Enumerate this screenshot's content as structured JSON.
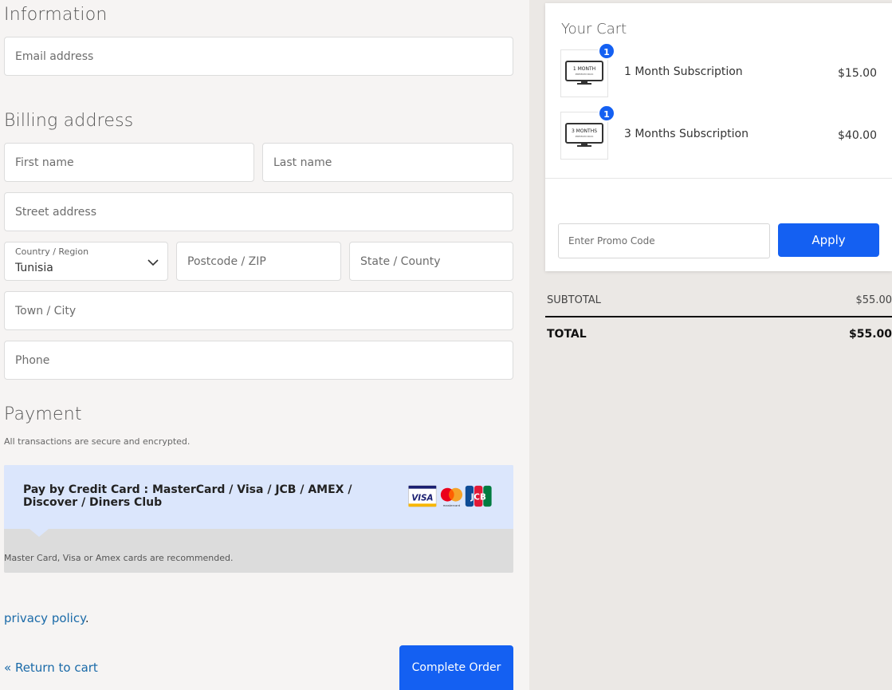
{
  "information": {
    "title": "Information",
    "email_placeholder": "Email address"
  },
  "billing": {
    "title": "Billing address",
    "first_name_placeholder": "First name",
    "last_name_placeholder": "Last name",
    "street_placeholder": "Street address",
    "country_label": "Country / Region",
    "country_value": "Tunisia",
    "postcode_placeholder": "Postcode / ZIP",
    "state_placeholder": "State / County",
    "town_placeholder": "Town / City",
    "phone_placeholder": "Phone"
  },
  "payment": {
    "title": "Payment",
    "subtitle": "All transactions are secure and encrypted.",
    "method_label": "Pay by Credit Card : MasterCard / Visa / JCB / AMEX / Discover / Diners Club",
    "note": "Master Card, Visa or Amex cards are recommended.",
    "card_logos": [
      "visa-logo",
      "mastercard-logo",
      "jcb-logo"
    ]
  },
  "footer": {
    "privacy_link": "privacy policy",
    "privacy_suffix": ".",
    "return_link": "« Return to cart",
    "complete_button": "Complete Order"
  },
  "cart": {
    "title": "Your Cart",
    "items": [
      {
        "name": "1 Month Subscription",
        "price": "$15.00",
        "qty": "1",
        "thumb_text": "1 MONTH",
        "thumb_sub": "PREMIUM PACK"
      },
      {
        "name": "3 Months Subscription",
        "price": "$40.00",
        "qty": "1",
        "thumb_text": "3 MONTHS",
        "thumb_sub": "PREMIUM PACK"
      }
    ],
    "promo_placeholder": "Enter Promo Code",
    "apply_button": "Apply"
  },
  "summary": {
    "subtotal_label": "SUBTOTAL",
    "subtotal_value": "$55.00",
    "total_label": "TOTAL",
    "total_value": "$55.00"
  },
  "colors": {
    "accent": "#1460f2",
    "link": "#1a6aa8",
    "payment_header_bg": "#dbe6fc"
  }
}
